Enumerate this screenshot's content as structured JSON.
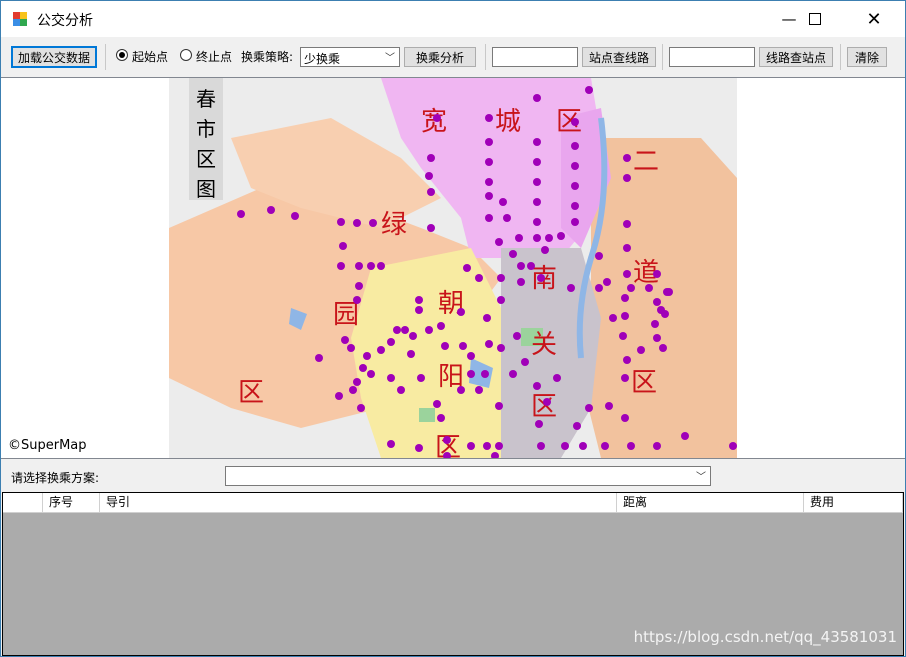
{
  "window": {
    "title": "公交分析"
  },
  "toolbar": {
    "load_btn": "加载公交数据",
    "radio_start": "起始点",
    "radio_end": "终止点",
    "strategy_label": "换乘策略:",
    "strategy_value": "少换乘",
    "transfer_btn": "换乘分析",
    "station_query_btn": "站点查线路",
    "line_query_btn": "线路查站点",
    "clear_btn": "清除"
  },
  "map": {
    "copyright": "©SuperMap",
    "legend_title": "春市区图",
    "district_labels": [
      "宽",
      "城",
      "区",
      "绿",
      "二",
      "道",
      "南",
      "园",
      "朝",
      "关",
      "阳",
      "区",
      "区",
      "区",
      "区"
    ]
  },
  "bottom": {
    "scheme_label": "请选择换乘方案:",
    "columns": [
      "序号",
      "导引",
      "距离",
      "费用"
    ]
  },
  "watermark": "https://blog.csdn.net/qq_43581031"
}
